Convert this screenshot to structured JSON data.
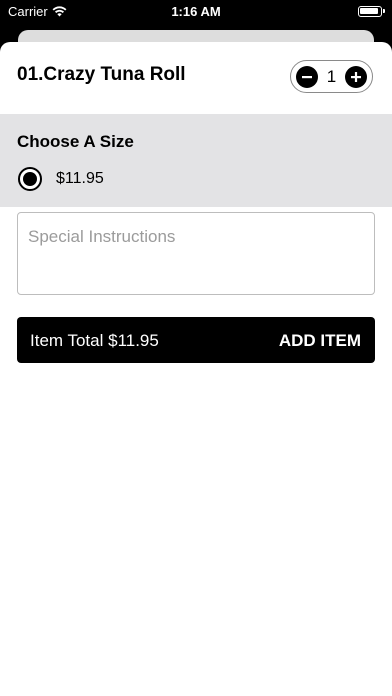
{
  "status_bar": {
    "carrier": "Carrier",
    "time": "1:16 AM"
  },
  "header": {
    "item_name": "01.Crazy Tuna Roll",
    "quantity": "1",
    "minus_icon": "minus-circle-icon",
    "plus_icon": "plus-circle-icon"
  },
  "size": {
    "heading": "Choose A Size",
    "options": [
      {
        "price": "$11.95",
        "selected": true
      }
    ]
  },
  "instructions": {
    "placeholder": "Special Instructions",
    "value": ""
  },
  "add_bar": {
    "total_label": "Item Total $11.95",
    "button_label": "ADD ITEM"
  },
  "colors": {
    "accent": "#000000",
    "section_bg": "#e3e3e5"
  }
}
